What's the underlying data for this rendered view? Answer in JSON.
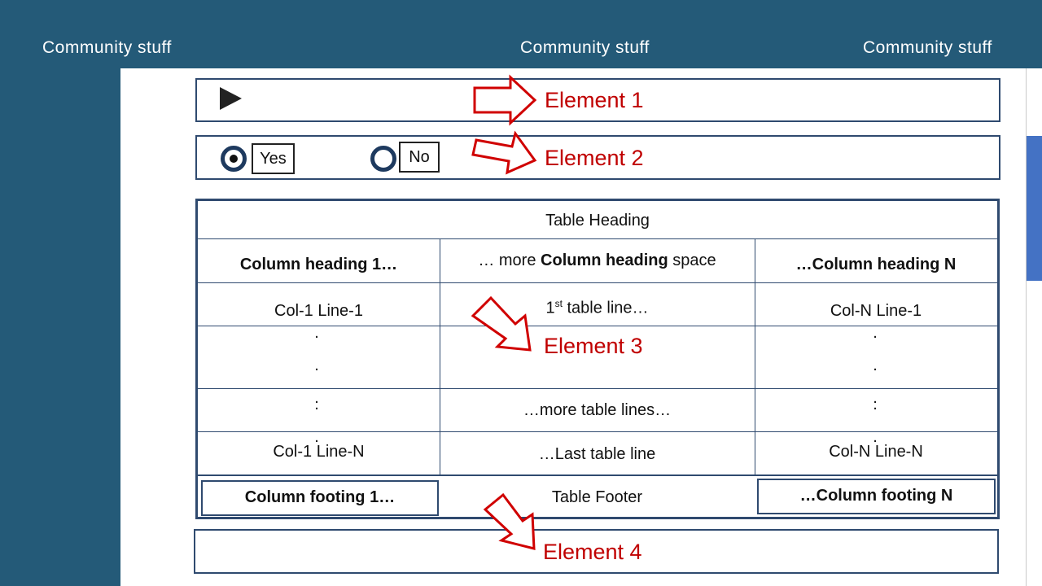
{
  "header": {
    "left": "Community stuff",
    "center": "Community stuff",
    "right": "Community stuff"
  },
  "radio_group": {
    "options": [
      {
        "label": "Yes",
        "selected": true
      },
      {
        "label": "No",
        "selected": false
      }
    ]
  },
  "table": {
    "heading": "Table Heading",
    "column_headings": {
      "col1": "Column heading 1…",
      "middle_prefix": "… more ",
      "middle_bold": "Column heading",
      "middle_suffix": " space",
      "colN": "…Column heading N"
    },
    "rows": {
      "first": {
        "col1": "Col-1 Line-1",
        "middle_prefix": "1",
        "middle_sup": "st",
        "middle_suffix": " table line…",
        "colN": "Col-N Line-1"
      },
      "more": {
        "middle": "…more table lines…"
      },
      "last": {
        "col1": "Col-1 Line-N",
        "middle": "…Last table line",
        "colN": "Col-N Line-N"
      }
    },
    "footer": {
      "col1": "Column footing 1…",
      "middle": "Table Footer",
      "colN": "…Column footing N"
    }
  },
  "callouts": [
    {
      "label": "Element 1"
    },
    {
      "label": "Element 2"
    },
    {
      "label": "Element 3"
    },
    {
      "label": "Element 4"
    }
  ],
  "colors": {
    "background": "#245a78",
    "border": "#2f4a6f",
    "callout": "#c00000",
    "scroll_thumb": "#4472c4"
  }
}
